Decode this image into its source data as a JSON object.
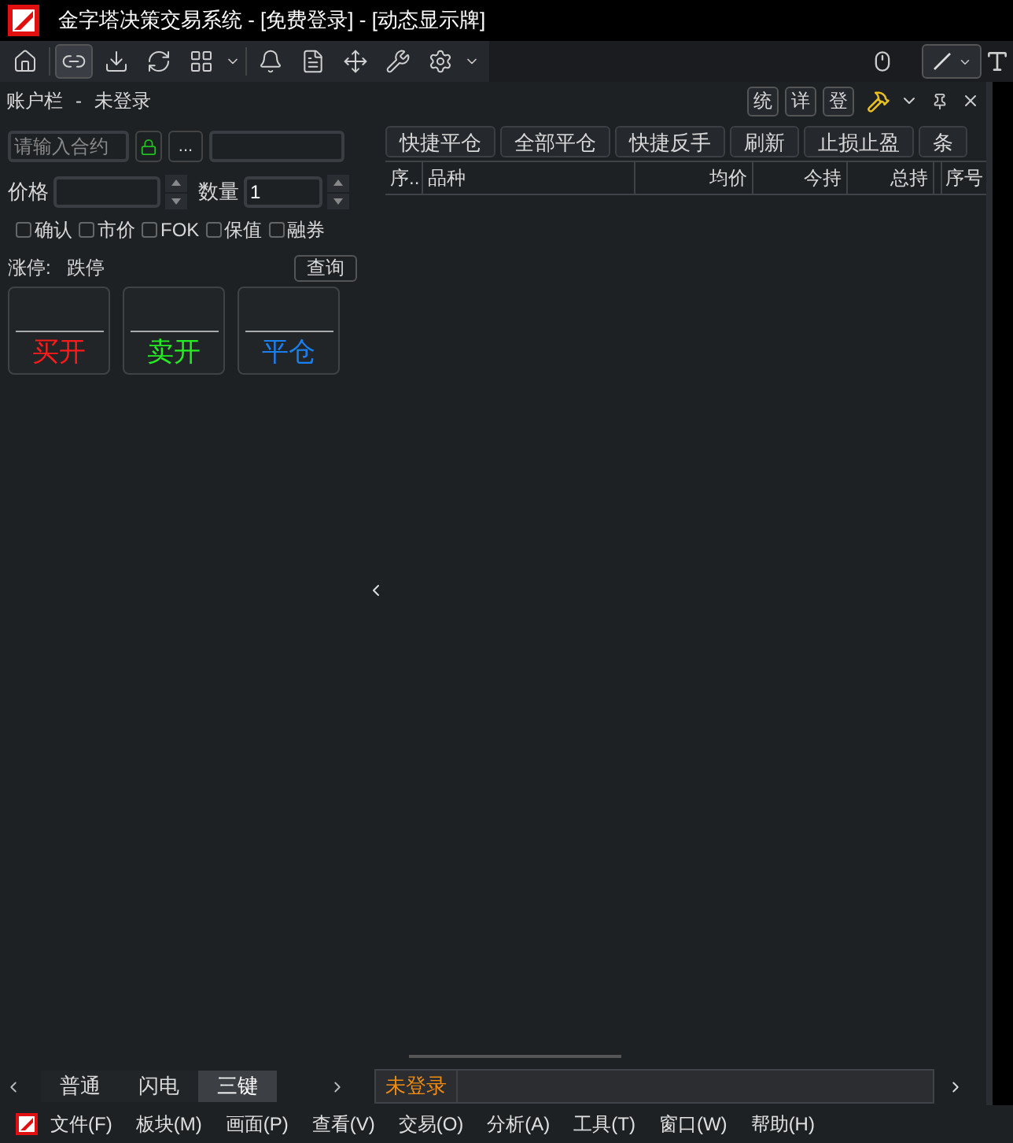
{
  "window": {
    "title": "金字塔决策交易系统 - [免费登录] - [动态显示牌]"
  },
  "toolbar": [
    {
      "kind": "home",
      "selected": false
    },
    {
      "kind": "link",
      "selected": true
    },
    {
      "kind": "download",
      "selected": false
    },
    {
      "kind": "refresh",
      "selected": false
    },
    {
      "kind": "grid",
      "selected": false
    },
    {
      "kind": "bell",
      "selected": false
    },
    {
      "kind": "document",
      "selected": false
    },
    {
      "kind": "move",
      "selected": false
    },
    {
      "kind": "tools",
      "selected": false
    },
    {
      "kind": "gear",
      "selected": false
    }
  ],
  "account_bar": {
    "title": "账户栏",
    "separator": "-",
    "status": "未登录",
    "buttons": [
      "统",
      "详",
      "登"
    ]
  },
  "order_form": {
    "contract_placeholder": "请输入合约",
    "more_button": "...",
    "price_label": "价格",
    "qty_label": "数量",
    "qty_value": "1",
    "options": [
      {
        "label": "确认",
        "checked": false
      },
      {
        "label": "市价",
        "checked": false
      },
      {
        "label": "FOK",
        "checked": false
      },
      {
        "label": "保值",
        "checked": false
      },
      {
        "label": "融券",
        "checked": false
      }
    ],
    "limit_up": "涨停:",
    "limit_down": "跌停",
    "query_button": "查询",
    "actions": [
      {
        "label": "买开",
        "color": "#ff1a1a"
      },
      {
        "label": "卖开",
        "color": "#22ee22"
      },
      {
        "label": "平仓",
        "color": "#1a7ff0"
      }
    ]
  },
  "quick_buttons": [
    "快捷平仓",
    "全部平仓",
    "快捷反手",
    "刷新",
    "止损止盈",
    "条"
  ],
  "table": {
    "columns": [
      "序..",
      "品种",
      "均价",
      "今持",
      "总持"
    ],
    "side_column": "序号"
  },
  "left_tabs": [
    {
      "label": "普通",
      "selected": false
    },
    {
      "label": "闪电",
      "selected": false
    },
    {
      "label": "三键",
      "selected": true
    }
  ],
  "status_tab": "未登录",
  "menu": [
    "文件(F)",
    "板块(M)",
    "画面(P)",
    "查看(V)",
    "交易(O)",
    "分析(A)",
    "工具(T)",
    "窗口(W)",
    "帮助(H)"
  ]
}
